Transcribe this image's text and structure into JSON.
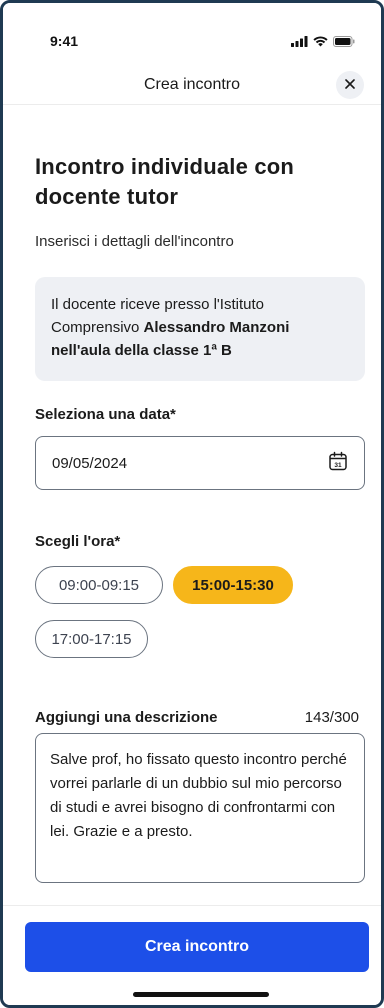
{
  "status_bar": {
    "time": "9:41"
  },
  "nav": {
    "title": "Crea incontro",
    "close_label": "×"
  },
  "heading": "Incontro individuale con docente tutor",
  "subtitle": "Inserisci i dettagli dell'incontro",
  "info": {
    "prefix": "Il docente riceve presso l'Istituto Comprensivo ",
    "bold": "Alessandro Manzoni nell'aula della classe 1ª B"
  },
  "date": {
    "label": "Seleziona una data*",
    "value": "09/05/2024",
    "calendar_day": "31"
  },
  "time": {
    "label": "Scegli l'ora*",
    "slots": [
      {
        "label": "09:00-09:15",
        "selected": false
      },
      {
        "label": "15:00-15:30",
        "selected": true
      },
      {
        "label": "17:00-17:15",
        "selected": false
      }
    ]
  },
  "description": {
    "label": "Aggiungi una descrizione",
    "counter": "143/300",
    "text": "Salve prof, ho fissato questo incontro perché vorrei parlarle di un dubbio sul mio percorso di studi e avrei bisogno di confrontarmi con lei. Grazie e a presto."
  },
  "footer": {
    "button_label": "Crea incontro"
  },
  "colors": {
    "primary": "#1d4fe8",
    "selected_chip": "#f6b61a",
    "info_bg": "#eef0f4"
  }
}
